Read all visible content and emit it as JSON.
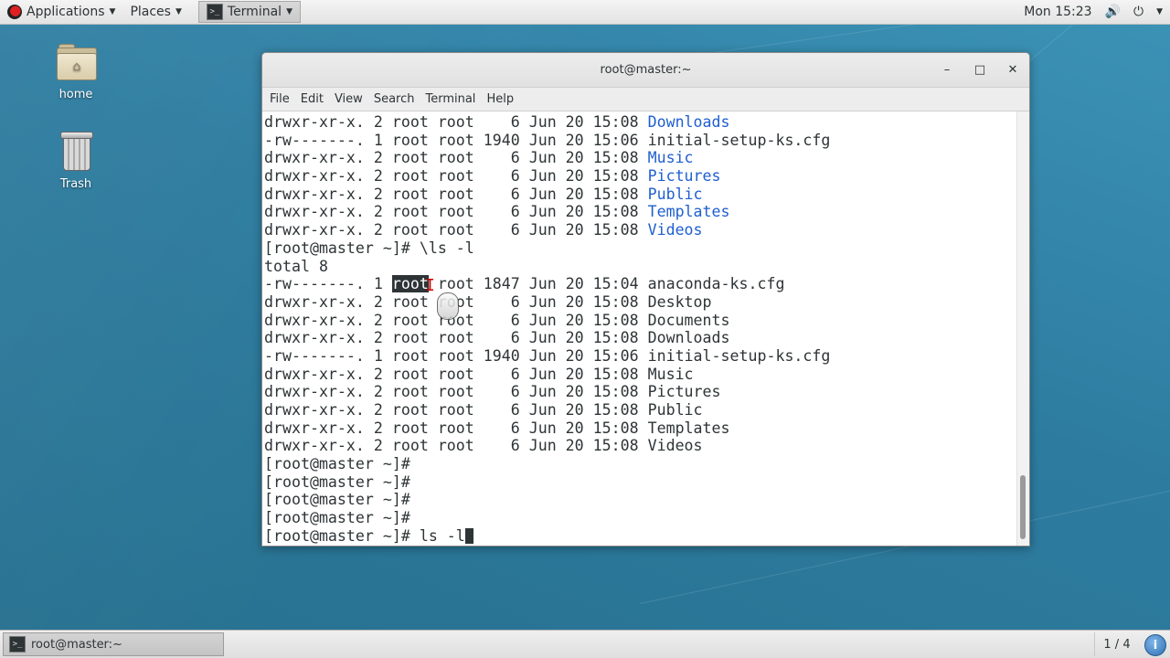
{
  "top_panel": {
    "applications": "Applications",
    "places": "Places",
    "terminal_task": "Terminal",
    "clock": "Mon 15:23"
  },
  "desktop": {
    "icons": [
      {
        "label": "home",
        "icon": "home-folder-icon"
      },
      {
        "label": "Trash",
        "icon": "trash-icon"
      }
    ]
  },
  "window": {
    "title": "root@master:~",
    "buttons": {
      "minimize": "–",
      "maximize": "□",
      "close": "✕"
    },
    "menu": [
      "File",
      "Edit",
      "View",
      "Search",
      "Terminal",
      "Help"
    ]
  },
  "terminal": {
    "lines": [
      {
        "text": "drwxr-xr-x. 2 root root    6 Jun 20 15:08 ",
        "name": "Downloads",
        "color": "blue"
      },
      {
        "text": "-rw-------. 1 root root 1940 Jun 20 15:06 initial-setup-ks.cfg"
      },
      {
        "text": "drwxr-xr-x. 2 root root    6 Jun 20 15:08 ",
        "name": "Music",
        "color": "blue"
      },
      {
        "text": "drwxr-xr-x. 2 root root    6 Jun 20 15:08 ",
        "name": "Pictures",
        "color": "blue"
      },
      {
        "text": "drwxr-xr-x. 2 root root    6 Jun 20 15:08 ",
        "name": "Public",
        "color": "blue"
      },
      {
        "text": "drwxr-xr-x. 2 root root    6 Jun 20 15:08 ",
        "name": "Templates",
        "color": "blue"
      },
      {
        "text": "drwxr-xr-x. 2 root root    6 Jun 20 15:08 ",
        "name": "Videos",
        "color": "blue"
      },
      {
        "text": "[root@master ~]# \\ls -l"
      },
      {
        "text": "total 8"
      },
      {
        "pre": "-rw-------. 1 ",
        "sel": "root",
        "post": " root 1847 Jun 20 15:04 anaconda-ks.cfg"
      },
      {
        "text": "drwxr-xr-x. 2 root root    6 Jun 20 15:08 Desktop"
      },
      {
        "text": "drwxr-xr-x. 2 root root    6 Jun 20 15:08 Documents"
      },
      {
        "text": "drwxr-xr-x. 2 root root    6 Jun 20 15:08 Downloads"
      },
      {
        "text": "-rw-------. 1 root root 1940 Jun 20 15:06 initial-setup-ks.cfg"
      },
      {
        "text": "drwxr-xr-x. 2 root root    6 Jun 20 15:08 Music"
      },
      {
        "text": "drwxr-xr-x. 2 root root    6 Jun 20 15:08 Pictures"
      },
      {
        "text": "drwxr-xr-x. 2 root root    6 Jun 20 15:08 Public"
      },
      {
        "text": "drwxr-xr-x. 2 root root    6 Jun 20 15:08 Templates"
      },
      {
        "text": "drwxr-xr-x. 2 root root    6 Jun 20 15:08 Videos"
      },
      {
        "text": "[root@master ~]#"
      },
      {
        "text": "[root@master ~]#"
      },
      {
        "text": "[root@master ~]#"
      },
      {
        "text": "[root@master ~]#"
      },
      {
        "text": "[root@master ~]# ls -l",
        "cursor": true
      }
    ],
    "colors": {
      "blue": "#1f5fcf",
      "text": "#2e3436"
    }
  },
  "bottom_panel": {
    "task_label": "root@master:~",
    "workspace": "1 / 4",
    "info": "i"
  }
}
